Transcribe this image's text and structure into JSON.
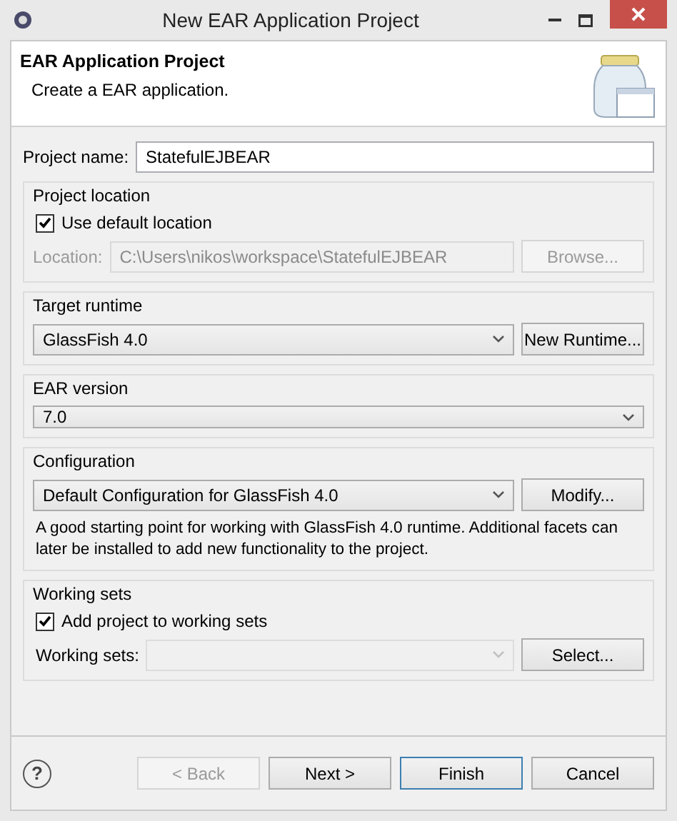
{
  "window": {
    "title": "New EAR Application Project"
  },
  "header": {
    "title": "EAR Application Project",
    "subtitle": "Create a EAR application."
  },
  "project_name": {
    "label": "Project name:",
    "value": "StatefulEJBEAR"
  },
  "project_location": {
    "title": "Project location",
    "use_default": {
      "label": "Use default location",
      "checked": true
    },
    "location": {
      "label": "Location:",
      "value": "C:\\Users\\nikos\\workspace\\StatefulEJBEAR",
      "disabled": true
    },
    "browse": {
      "label": "Browse...",
      "disabled": true
    }
  },
  "target_runtime": {
    "title": "Target runtime",
    "value": "GlassFish 4.0",
    "button": {
      "label": "New Runtime...",
      "disabled": false
    }
  },
  "ear_version": {
    "title": "EAR version",
    "value": "7.0"
  },
  "configuration": {
    "title": "Configuration",
    "value": "Default Configuration for GlassFish 4.0",
    "button": {
      "label": "Modify...",
      "disabled": false
    },
    "description": "A good starting point for working with GlassFish 4.0 runtime. Additional facets can later be installed to add new functionality to the project."
  },
  "working_sets": {
    "title": "Working sets",
    "add": {
      "label": "Add project to working sets",
      "checked": true
    },
    "sets": {
      "label": "Working sets:",
      "disabled": true
    },
    "select": {
      "label": "Select...",
      "disabled": false
    }
  },
  "help": "?",
  "buttons": [
    {
      "label": "< Back",
      "disabled": true,
      "default": false
    },
    {
      "label": "Next >",
      "disabled": false,
      "default": false
    },
    {
      "label": "Finish",
      "disabled": false,
      "default": true
    },
    {
      "label": "Cancel",
      "disabled": false,
      "default": false
    }
  ]
}
